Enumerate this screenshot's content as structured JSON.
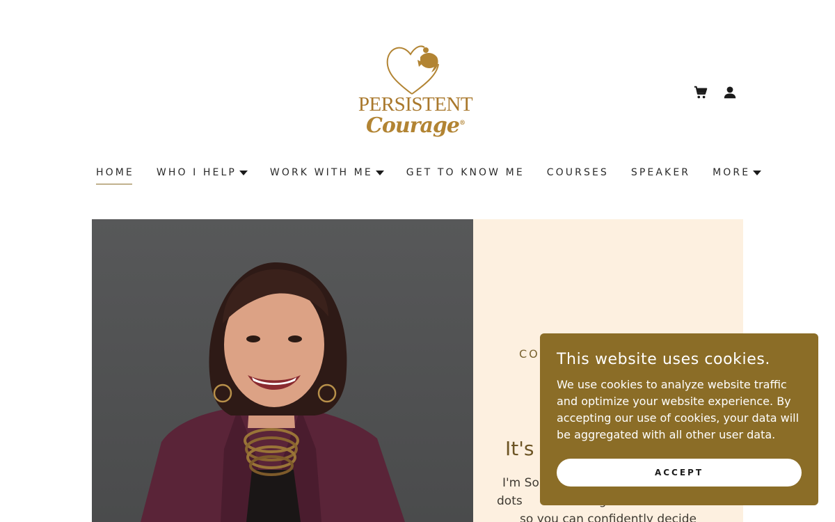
{
  "brand": {
    "logo_line1": "PERSISTENT",
    "logo_line2": "Courage",
    "logo_mark": "®",
    "accent_color": "#a9782c"
  },
  "header": {
    "icons": [
      "cart-icon",
      "account-icon"
    ]
  },
  "nav": {
    "items": [
      {
        "label": "HOME",
        "active": true,
        "dropdown": false
      },
      {
        "label": "WHO I HELP",
        "active": false,
        "dropdown": true
      },
      {
        "label": "WORK WITH ME",
        "active": false,
        "dropdown": true
      },
      {
        "label": "GET TO KNOW ME",
        "active": false,
        "dropdown": false
      },
      {
        "label": "COURSES",
        "active": false,
        "dropdown": false
      },
      {
        "label": "SPEAKER",
        "active": false,
        "dropdown": false
      },
      {
        "label": "MORE",
        "active": false,
        "dropdown": true
      }
    ]
  },
  "hero": {
    "eyebrow": "CO",
    "headline": "It's",
    "body_line1": "I'm So",
    "body_line2": "dots",
    "body_line2b": "g",
    "body_line3": "so you can confidently decide",
    "panel_color": "#fdf0e0"
  },
  "cookie": {
    "title": "This website uses cookies.",
    "body": "We use cookies to analyze website traffic and optimize your website experience. By accepting our use of cookies, your data will be aggregated with all other user data.",
    "accept_label": "ACCEPT",
    "bg_color": "#8b6d27"
  }
}
